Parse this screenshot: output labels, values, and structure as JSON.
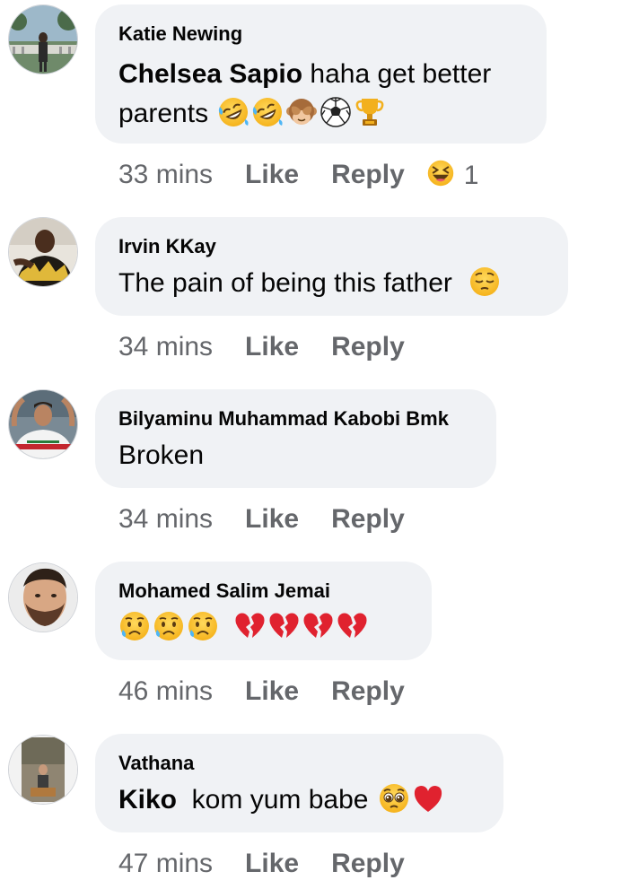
{
  "comments": [
    {
      "author": "Katie Newing",
      "mention": "Chelsea Sapio",
      "text_line1": " haha get better",
      "text_line2": "parents",
      "emojis": [
        "rofl-emoji",
        "rofl-emoji",
        "see-no-evil-monkey-emoji",
        "soccer-ball-emoji",
        "trophy-emoji"
      ],
      "time": "33 mins",
      "like_label": "Like",
      "reply_label": "Reply",
      "reaction_icon": "laughing-emoji",
      "reaction_count": "1"
    },
    {
      "author": "Irvin KKay",
      "text": "The pain of being this father",
      "emojis": [
        "pensive-face-emoji"
      ],
      "time": "34 mins",
      "like_label": "Like",
      "reply_label": "Reply"
    },
    {
      "author": "Bilyaminu Muhammad Kabobi Bmk",
      "text": "Broken",
      "time": "34 mins",
      "like_label": "Like",
      "reply_label": "Reply"
    },
    {
      "author": "Mohamed Salim Jemai",
      "emojis": [
        "sad-relieved-face-emoji",
        "sad-relieved-face-emoji",
        "sad-relieved-face-emoji",
        "broken-heart-emoji",
        "broken-heart-emoji",
        "broken-heart-emoji",
        "broken-heart-emoji"
      ],
      "time": "46 mins",
      "like_label": "Like",
      "reply_label": "Reply"
    },
    {
      "author": "Vathana",
      "mention": "Kiko",
      "text": "  kom yum babe",
      "emojis": [
        "pleading-face-emoji",
        "red-heart-emoji"
      ],
      "time": "47 mins",
      "like_label": "Like",
      "reply_label": "Reply"
    }
  ],
  "colors": {
    "bubble": "#f0f2f5",
    "secondary_text": "#65676b",
    "primary_text": "#050505"
  }
}
